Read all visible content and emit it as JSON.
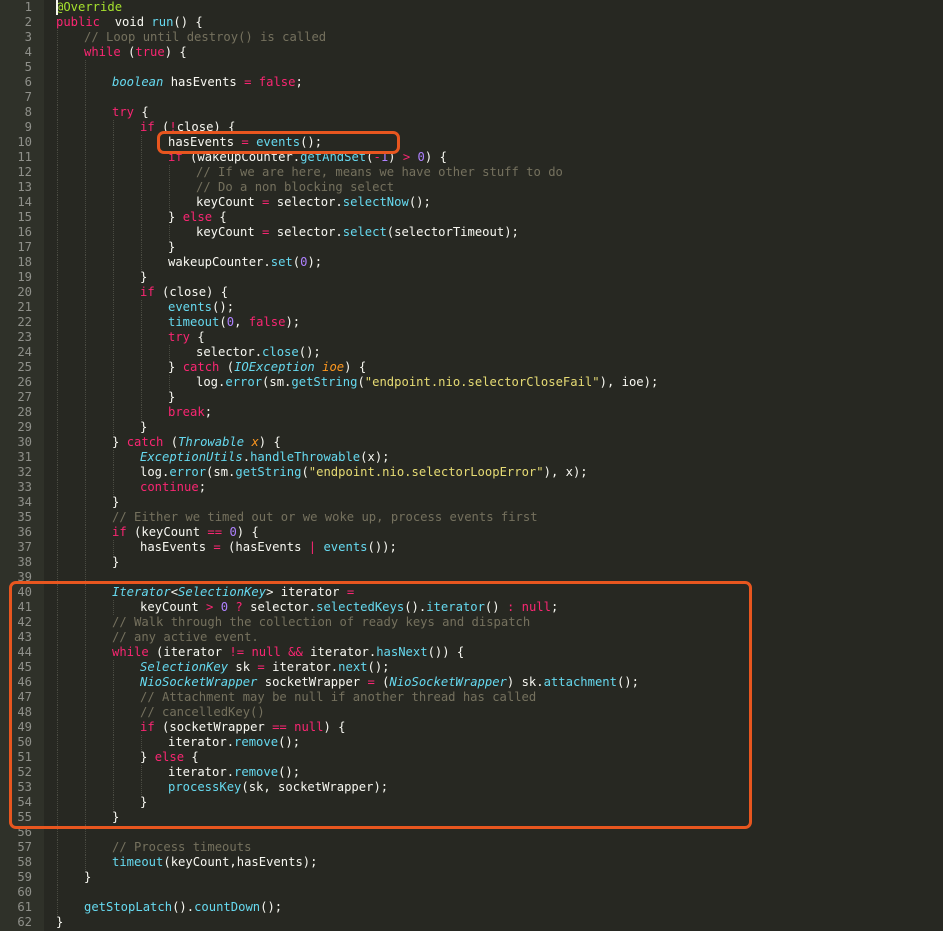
{
  "colors": {
    "background": "#272822",
    "gutter": "#2f3129",
    "line_number": "#8f908a",
    "default_text": "#f8f8f2",
    "keyword": "#f92672",
    "function": "#66d9ef",
    "number": "#ae81ff",
    "string": "#e6db74",
    "comment": "#75715e",
    "parameter": "#fd971f",
    "annotation": "#a6e22e",
    "highlight_box": "#e8561f"
  },
  "editor": {
    "highlights": [
      {
        "name": "highlight-box-events-call",
        "from_line": 10,
        "to_line": 10
      },
      {
        "name": "highlight-box-iterator-block",
        "from_line": 40,
        "to_line": 55
      }
    ],
    "lines": [
      {
        "n": "1",
        "indent": 0,
        "tokens": [
          [
            "ann",
            "@Override"
          ]
        ]
      },
      {
        "n": "2",
        "indent": 0,
        "tokens": [
          [
            "kw",
            "public"
          ],
          [
            "",
            "  "
          ],
          [
            "",
            "void "
          ],
          [
            "fn",
            "run"
          ],
          [
            "",
            "() {"
          ]
        ]
      },
      {
        "n": "3",
        "indent": 1,
        "tokens": [
          [
            "cm",
            "// Loop until destroy() is called"
          ]
        ]
      },
      {
        "n": "4",
        "indent": 1,
        "tokens": [
          [
            "kw",
            "while"
          ],
          [
            "",
            " ("
          ],
          [
            "kw",
            "true"
          ],
          [
            "",
            ") {"
          ]
        ]
      },
      {
        "n": "5",
        "indent": 2,
        "tokens": []
      },
      {
        "n": "6",
        "indent": 2,
        "tokens": [
          [
            "ty",
            "boolean"
          ],
          [
            "",
            " hasEvents "
          ],
          [
            "kw",
            "="
          ],
          [
            "",
            " "
          ],
          [
            "kw",
            "false"
          ],
          [
            "",
            ";"
          ]
        ]
      },
      {
        "n": "7",
        "indent": 2,
        "tokens": []
      },
      {
        "n": "8",
        "indent": 2,
        "tokens": [
          [
            "kw",
            "try"
          ],
          [
            "",
            " {"
          ]
        ]
      },
      {
        "n": "9",
        "indent": 3,
        "tokens": [
          [
            "kw",
            "if"
          ],
          [
            "",
            " ("
          ],
          [
            "kw",
            "!"
          ],
          [
            "",
            "close) {"
          ]
        ]
      },
      {
        "n": "10",
        "indent": 4,
        "tokens": [
          [
            "",
            "hasEvents "
          ],
          [
            "kw",
            "="
          ],
          [
            "",
            " "
          ],
          [
            "fn",
            "events"
          ],
          [
            "",
            "();"
          ]
        ]
      },
      {
        "n": "11",
        "indent": 4,
        "tokens": [
          [
            "kw",
            "if"
          ],
          [
            "",
            " (wakeupCounter."
          ],
          [
            "fn",
            "getAndSet"
          ],
          [
            "",
            "("
          ],
          [
            "kw",
            "-"
          ],
          [
            "num",
            "1"
          ],
          [
            "",
            ") "
          ],
          [
            "kw",
            ">"
          ],
          [
            "",
            " "
          ],
          [
            "num",
            "0"
          ],
          [
            "",
            ") {"
          ]
        ]
      },
      {
        "n": "12",
        "indent": 5,
        "tokens": [
          [
            "cm",
            "// If we are here, means we have other stuff to do"
          ]
        ]
      },
      {
        "n": "13",
        "indent": 5,
        "tokens": [
          [
            "cm",
            "// Do a non blocking select"
          ]
        ]
      },
      {
        "n": "14",
        "indent": 5,
        "tokens": [
          [
            "",
            "keyCount "
          ],
          [
            "kw",
            "="
          ],
          [
            "",
            " selector."
          ],
          [
            "fn",
            "selectNow"
          ],
          [
            "",
            "();"
          ]
        ]
      },
      {
        "n": "15",
        "indent": 4,
        "tokens": [
          [
            "",
            "} "
          ],
          [
            "kw",
            "else"
          ],
          [
            "",
            " {"
          ]
        ]
      },
      {
        "n": "16",
        "indent": 5,
        "tokens": [
          [
            "",
            "keyCount "
          ],
          [
            "kw",
            "="
          ],
          [
            "",
            " selector."
          ],
          [
            "fn",
            "select"
          ],
          [
            "",
            "(selectorTimeout);"
          ]
        ]
      },
      {
        "n": "17",
        "indent": 4,
        "tokens": [
          [
            "",
            "}"
          ]
        ]
      },
      {
        "n": "18",
        "indent": 4,
        "tokens": [
          [
            "",
            "wakeupCounter."
          ],
          [
            "fn",
            "set"
          ],
          [
            "",
            "("
          ],
          [
            "num",
            "0"
          ],
          [
            "",
            ");"
          ]
        ]
      },
      {
        "n": "19",
        "indent": 3,
        "tokens": [
          [
            "",
            "}"
          ]
        ]
      },
      {
        "n": "20",
        "indent": 3,
        "tokens": [
          [
            "kw",
            "if"
          ],
          [
            "",
            " (close) {"
          ]
        ]
      },
      {
        "n": "21",
        "indent": 4,
        "tokens": [
          [
            "fn",
            "events"
          ],
          [
            "",
            "();"
          ]
        ]
      },
      {
        "n": "22",
        "indent": 4,
        "tokens": [
          [
            "fn",
            "timeout"
          ],
          [
            "",
            "("
          ],
          [
            "num",
            "0"
          ],
          [
            "",
            ", "
          ],
          [
            "kw",
            "false"
          ],
          [
            "",
            ");"
          ]
        ]
      },
      {
        "n": "23",
        "indent": 4,
        "tokens": [
          [
            "kw",
            "try"
          ],
          [
            "",
            " {"
          ]
        ]
      },
      {
        "n": "24",
        "indent": 5,
        "tokens": [
          [
            "",
            "selector."
          ],
          [
            "fn",
            "close"
          ],
          [
            "",
            "();"
          ]
        ]
      },
      {
        "n": "25",
        "indent": 4,
        "tokens": [
          [
            "",
            "} "
          ],
          [
            "kw",
            "catch"
          ],
          [
            "",
            " ("
          ],
          [
            "ty",
            "IOException"
          ],
          [
            "",
            " "
          ],
          [
            "par",
            "ioe"
          ],
          [
            "",
            ") {"
          ]
        ]
      },
      {
        "n": "26",
        "indent": 5,
        "tokens": [
          [
            "",
            "log."
          ],
          [
            "fn",
            "error"
          ],
          [
            "",
            "(sm."
          ],
          [
            "fn",
            "getString"
          ],
          [
            "",
            "("
          ],
          [
            "str",
            "\"endpoint.nio.selectorCloseFail\""
          ],
          [
            "",
            "), ioe);"
          ]
        ]
      },
      {
        "n": "27",
        "indent": 4,
        "tokens": [
          [
            "",
            "}"
          ]
        ]
      },
      {
        "n": "28",
        "indent": 4,
        "tokens": [
          [
            "kw",
            "break"
          ],
          [
            "",
            ";"
          ]
        ]
      },
      {
        "n": "29",
        "indent": 3,
        "tokens": [
          [
            "",
            "}"
          ]
        ]
      },
      {
        "n": "30",
        "indent": 2,
        "tokens": [
          [
            "",
            "} "
          ],
          [
            "kw",
            "catch"
          ],
          [
            "",
            " ("
          ],
          [
            "ty",
            "Throwable"
          ],
          [
            "",
            " "
          ],
          [
            "par",
            "x"
          ],
          [
            "",
            ") {"
          ]
        ]
      },
      {
        "n": "31",
        "indent": 3,
        "tokens": [
          [
            "ty",
            "ExceptionUtils"
          ],
          [
            "",
            "."
          ],
          [
            "fn",
            "handleThrowable"
          ],
          [
            "",
            "(x);"
          ]
        ]
      },
      {
        "n": "32",
        "indent": 3,
        "tokens": [
          [
            "",
            "log."
          ],
          [
            "fn",
            "error"
          ],
          [
            "",
            "(sm."
          ],
          [
            "fn",
            "getString"
          ],
          [
            "",
            "("
          ],
          [
            "str",
            "\"endpoint.nio.selectorLoopError\""
          ],
          [
            "",
            "), x);"
          ]
        ]
      },
      {
        "n": "33",
        "indent": 3,
        "tokens": [
          [
            "kw",
            "continue"
          ],
          [
            "",
            ";"
          ]
        ]
      },
      {
        "n": "34",
        "indent": 2,
        "tokens": [
          [
            "",
            "}"
          ]
        ]
      },
      {
        "n": "35",
        "indent": 2,
        "tokens": [
          [
            "cm",
            "// Either we timed out or we woke up, process events first"
          ]
        ]
      },
      {
        "n": "36",
        "indent": 2,
        "tokens": [
          [
            "kw",
            "if"
          ],
          [
            "",
            " (keyCount "
          ],
          [
            "kw",
            "=="
          ],
          [
            "",
            " "
          ],
          [
            "num",
            "0"
          ],
          [
            "",
            ") {"
          ]
        ]
      },
      {
        "n": "37",
        "indent": 3,
        "tokens": [
          [
            "",
            "hasEvents "
          ],
          [
            "kw",
            "="
          ],
          [
            "",
            " (hasEvents "
          ],
          [
            "kw",
            "|"
          ],
          [
            "",
            " "
          ],
          [
            "fn",
            "events"
          ],
          [
            "",
            "());"
          ]
        ]
      },
      {
        "n": "38",
        "indent": 2,
        "tokens": [
          [
            "",
            "}"
          ]
        ]
      },
      {
        "n": "39",
        "indent": 2,
        "tokens": []
      },
      {
        "n": "40",
        "indent": 2,
        "tokens": [
          [
            "ty",
            "Iterator"
          ],
          [
            "",
            "<"
          ],
          [
            "ty",
            "SelectionKey"
          ],
          [
            "",
            "> iterator "
          ],
          [
            "kw",
            "="
          ]
        ]
      },
      {
        "n": "41",
        "indent": 3,
        "tokens": [
          [
            "",
            "keyCount "
          ],
          [
            "kw",
            ">"
          ],
          [
            "",
            " "
          ],
          [
            "num",
            "0"
          ],
          [
            "",
            " "
          ],
          [
            "kw",
            "?"
          ],
          [
            "",
            " selector."
          ],
          [
            "fn",
            "selectedKeys"
          ],
          [
            "",
            "()."
          ],
          [
            "fn",
            "iterator"
          ],
          [
            "",
            "() "
          ],
          [
            "kw",
            ":"
          ],
          [
            "",
            " "
          ],
          [
            "kw",
            "null"
          ],
          [
            "",
            ";"
          ]
        ]
      },
      {
        "n": "42",
        "indent": 2,
        "tokens": [
          [
            "cm",
            "// Walk through the collection of ready keys and dispatch"
          ]
        ]
      },
      {
        "n": "43",
        "indent": 2,
        "tokens": [
          [
            "cm",
            "// any active event."
          ]
        ]
      },
      {
        "n": "44",
        "indent": 2,
        "tokens": [
          [
            "kw",
            "while"
          ],
          [
            "",
            " (iterator "
          ],
          [
            "kw",
            "!="
          ],
          [
            "",
            " "
          ],
          [
            "kw",
            "null"
          ],
          [
            "",
            " "
          ],
          [
            "kw",
            "&&"
          ],
          [
            "",
            " iterator."
          ],
          [
            "fn",
            "hasNext"
          ],
          [
            "",
            "()) {"
          ]
        ]
      },
      {
        "n": "45",
        "indent": 3,
        "tokens": [
          [
            "ty",
            "SelectionKey"
          ],
          [
            "",
            " sk "
          ],
          [
            "kw",
            "="
          ],
          [
            "",
            " iterator."
          ],
          [
            "fn",
            "next"
          ],
          [
            "",
            "();"
          ]
        ]
      },
      {
        "n": "46",
        "indent": 3,
        "tokens": [
          [
            "ty",
            "NioSocketWrapper"
          ],
          [
            "",
            " socketWrapper "
          ],
          [
            "kw",
            "="
          ],
          [
            "",
            " ("
          ],
          [
            "ty",
            "NioSocketWrapper"
          ],
          [
            "",
            ") sk."
          ],
          [
            "fn",
            "attachment"
          ],
          [
            "",
            "();"
          ]
        ]
      },
      {
        "n": "47",
        "indent": 3,
        "tokens": [
          [
            "cm",
            "// Attachment may be null if another thread has called"
          ]
        ]
      },
      {
        "n": "48",
        "indent": 3,
        "tokens": [
          [
            "cm",
            "// cancelledKey()"
          ]
        ]
      },
      {
        "n": "49",
        "indent": 3,
        "tokens": [
          [
            "kw",
            "if"
          ],
          [
            "",
            " (socketWrapper "
          ],
          [
            "kw",
            "=="
          ],
          [
            "",
            " "
          ],
          [
            "kw",
            "null"
          ],
          [
            "",
            ") {"
          ]
        ]
      },
      {
        "n": "50",
        "indent": 4,
        "tokens": [
          [
            "",
            "iterator."
          ],
          [
            "fn",
            "remove"
          ],
          [
            "",
            "();"
          ]
        ]
      },
      {
        "n": "51",
        "indent": 3,
        "tokens": [
          [
            "",
            "} "
          ],
          [
            "kw",
            "else"
          ],
          [
            "",
            " {"
          ]
        ]
      },
      {
        "n": "52",
        "indent": 4,
        "tokens": [
          [
            "",
            "iterator."
          ],
          [
            "fn",
            "remove"
          ],
          [
            "",
            "();"
          ]
        ]
      },
      {
        "n": "53",
        "indent": 4,
        "tokens": [
          [
            "fn",
            "processKey"
          ],
          [
            "",
            "(sk, socketWrapper);"
          ]
        ]
      },
      {
        "n": "54",
        "indent": 3,
        "tokens": [
          [
            "",
            "}"
          ]
        ]
      },
      {
        "n": "55",
        "indent": 2,
        "tokens": [
          [
            "",
            "}"
          ]
        ]
      },
      {
        "n": "56",
        "indent": 2,
        "tokens": []
      },
      {
        "n": "57",
        "indent": 2,
        "tokens": [
          [
            "cm",
            "// Process timeouts"
          ]
        ]
      },
      {
        "n": "58",
        "indent": 2,
        "tokens": [
          [
            "fn",
            "timeout"
          ],
          [
            "",
            "(keyCount,hasEvents);"
          ]
        ]
      },
      {
        "n": "59",
        "indent": 1,
        "tokens": [
          [
            "",
            "}"
          ]
        ]
      },
      {
        "n": "60",
        "indent": 1,
        "tokens": []
      },
      {
        "n": "61",
        "indent": 1,
        "tokens": [
          [
            "fn",
            "getStopLatch"
          ],
          [
            "",
            "()."
          ],
          [
            "fn",
            "countDown"
          ],
          [
            "",
            "();"
          ]
        ]
      },
      {
        "n": "62",
        "indent": 0,
        "tokens": [
          [
            "",
            "}"
          ]
        ]
      }
    ]
  }
}
